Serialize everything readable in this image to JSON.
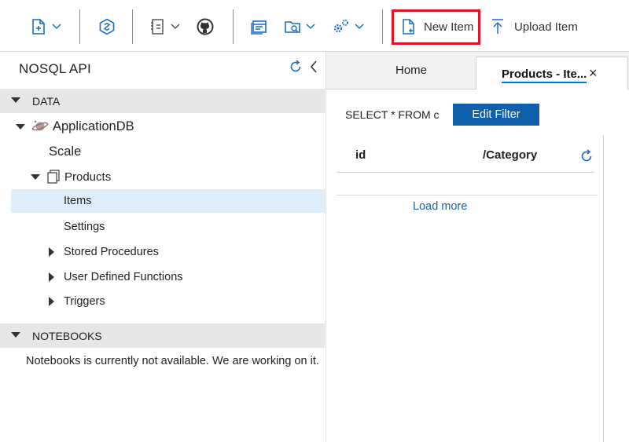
{
  "toolbar": {
    "new_item_label": "New Item",
    "upload_item_label": "Upload Item"
  },
  "left_pane": {
    "api_title": "NOSQL API",
    "data_section_title": "DATA",
    "database_name": "ApplicationDB",
    "scale_label": "Scale",
    "container_name": "Products",
    "items_label": "Items",
    "settings_label": "Settings",
    "stored_procedures_label": "Stored Procedures",
    "udf_label": "User Defined Functions",
    "triggers_label": "Triggers",
    "notebooks_section_title": "NOTEBOOKS",
    "notebooks_message": "Notebooks is currently not available. We are working on it."
  },
  "tabs": {
    "home_label": "Home",
    "active_label": "Products - Ite...",
    "close_glyph": "×"
  },
  "query_panel": {
    "query_text": "SELECT * FROM c",
    "edit_filter_label": "Edit Filter",
    "columns": [
      "id",
      "/Category"
    ],
    "load_more_label": "Load more"
  },
  "colors": {
    "accent": "#0f5fad",
    "highlight_border": "#e81123",
    "selected_row": "#ddeefa",
    "section_header": "#e6e6e6"
  }
}
